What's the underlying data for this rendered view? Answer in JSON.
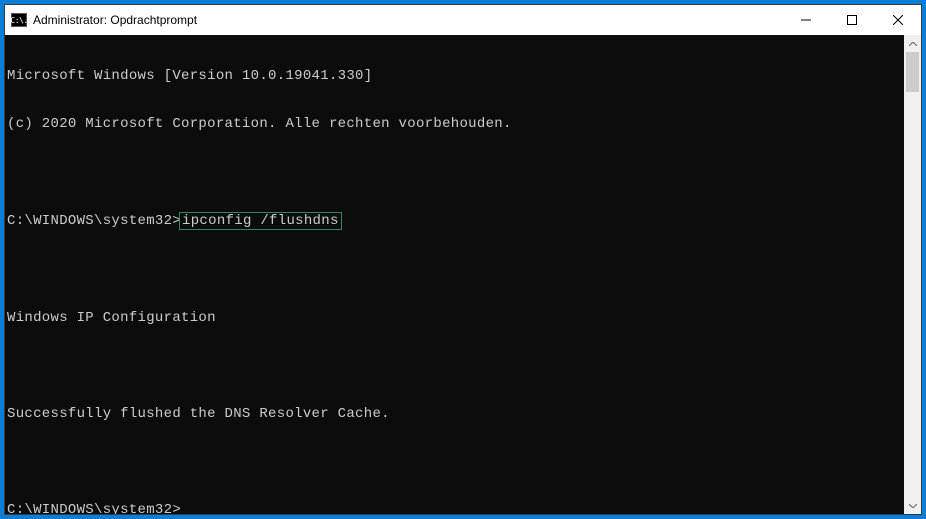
{
  "window": {
    "title": "Administrator: Opdrachtprompt",
    "icon_glyph": "C:\\."
  },
  "terminal": {
    "lines": [
      "Microsoft Windows [Version 10.0.19041.330]",
      "(c) 2020 Microsoft Corporation. Alle rechten voorbehouden.",
      "",
      "",
      "",
      "Windows IP Configuration",
      "",
      "Successfully flushed the DNS Resolver Cache.",
      "",
      "C:\\WINDOWS\\system32>"
    ],
    "prompt_line": {
      "prompt": "C:\\WINDOWS\\system32>",
      "command": "ipconfig /flushdns"
    }
  }
}
